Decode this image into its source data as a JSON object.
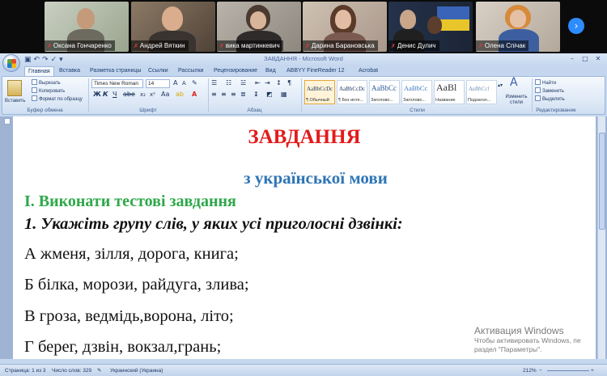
{
  "participants": [
    {
      "name": "Оксана Гончаренко",
      "muted": true
    },
    {
      "name": "Андрей Вяткин",
      "muted": true
    },
    {
      "name": "вика мартинкевич",
      "muted": true
    },
    {
      "name": "Дарина Барановська",
      "muted": true
    },
    {
      "name": "Денис Дулич",
      "muted": true
    },
    {
      "name": "Олена Спічак",
      "muted": true,
      "active_speaker": true
    }
  ],
  "strip": {
    "next_icon": "›",
    "next_icon_name": "chevron-right-icon"
  },
  "word": {
    "title": "ЗАВДАННЯ - Microsoft Word",
    "tabs": [
      "Главная",
      "Вставка",
      "Разметка страницы",
      "Ссылки",
      "Рассылки",
      "Рецензирование",
      "Вид",
      "ABBYY FineReader 12",
      "Acrobat"
    ],
    "active_tab": "Главная",
    "clipboard": {
      "paste": "Вставить",
      "cut": "Вырезать",
      "copy": "Копировать",
      "format_painter": "Формат по образцу",
      "label": "Буфер обмена"
    },
    "font": {
      "family": "Times New Roman",
      "size": "14",
      "label": "Шрифт"
    },
    "paragraph": {
      "label": "Абзац"
    },
    "styles": {
      "label": "Стили",
      "items": [
        {
          "sample": "AaBbCcDc",
          "caption": "¶ Обычный",
          "selected": true
        },
        {
          "sample": "AaBbCcDc",
          "caption": "¶ Без инте...",
          "selected": false
        },
        {
          "sample": "AaBbCc",
          "caption": "Заголово...",
          "selected": false
        },
        {
          "sample": "AaBbCc",
          "caption": "Заголово...",
          "selected": false
        },
        {
          "sample": "AaBl",
          "caption": "Название",
          "selected": false
        },
        {
          "sample": "AaBbCcl",
          "caption": "Подзагол...",
          "selected": false
        }
      ],
      "change_styles": "Изменить стили"
    },
    "editing": {
      "find": "Найти",
      "replace": "Заменить",
      "select": "Выделить",
      "label": "Редактирование"
    }
  },
  "document": {
    "title": "ЗАВДАННЯ",
    "subtitle": "з української мови",
    "section": "І. Виконати тестові завдання",
    "question": "1. Укажіть групу слів, у яких усі приголосні дзвінкі:",
    "options": [
      "А жменя, зілля, дорога, книга;",
      "Б білка, морози, райдуга, злива;",
      "В гроза, ведмідь,ворона, літо;",
      "Г берег, дзвін, вокзал,грань;"
    ]
  },
  "status_bar": {
    "page": "Страница: 1 из 3",
    "words": "Число слов: 329",
    "language": "Украинский (Украина)",
    "zoom": "212%"
  },
  "activation": {
    "title": "Активация Windows",
    "line1": "Чтобы активировать Windows, пе",
    "line2": "раздел \"Параметры\"."
  }
}
